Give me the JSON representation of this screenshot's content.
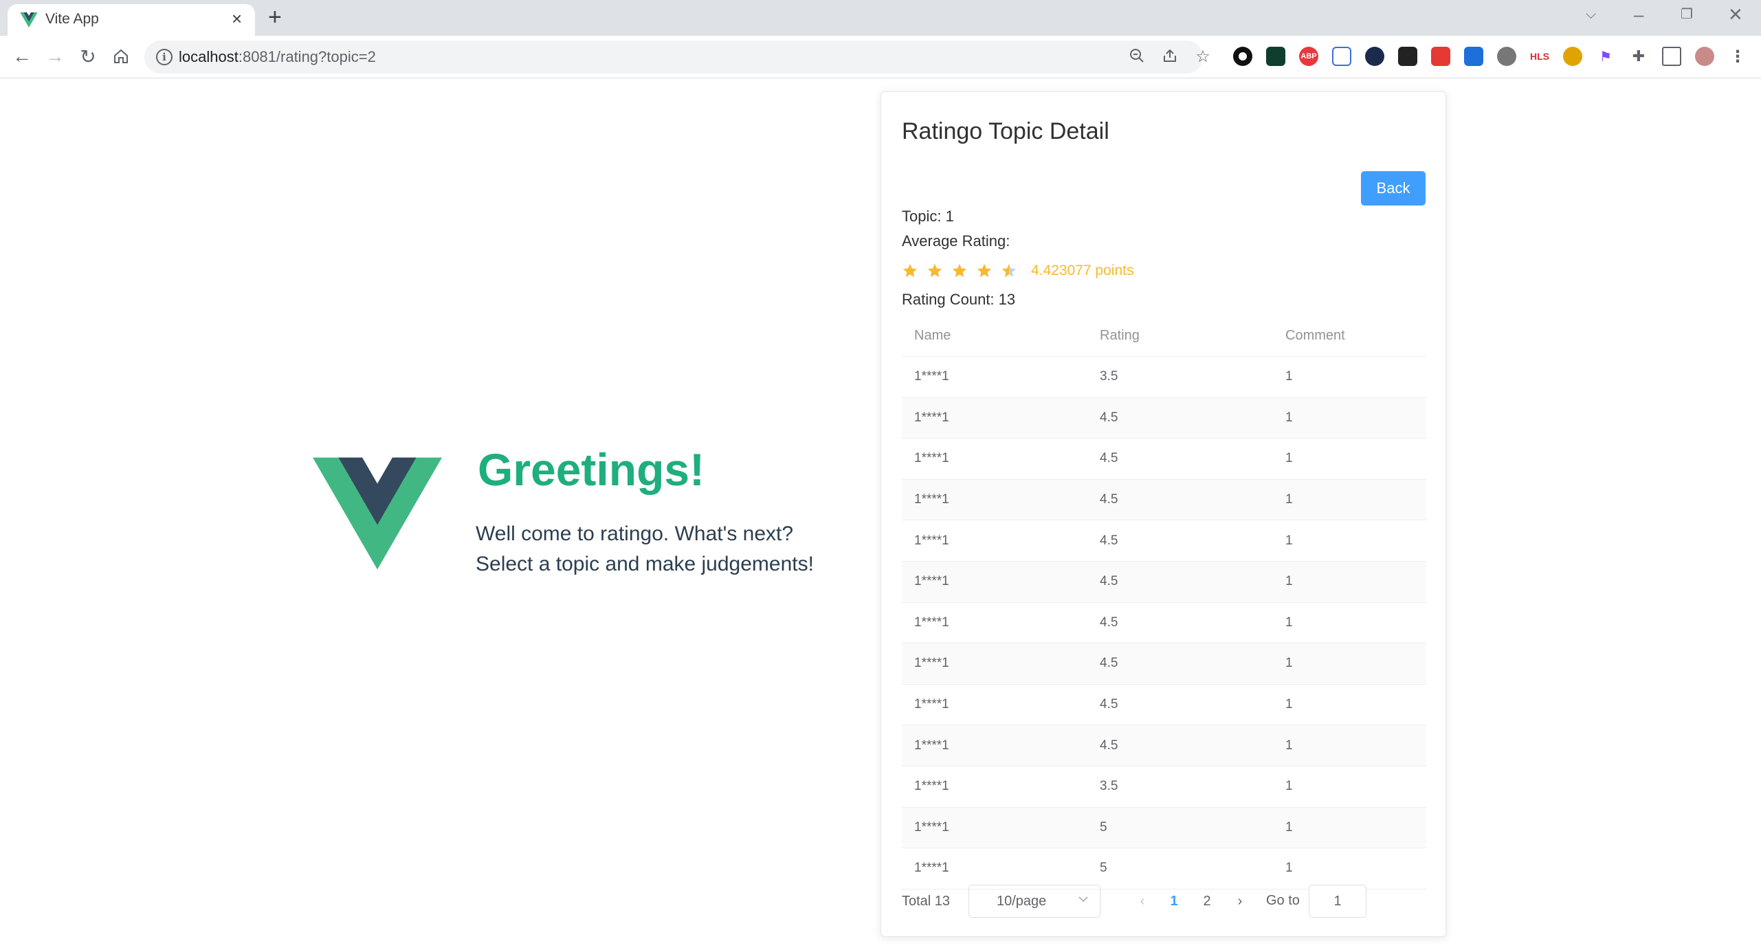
{
  "browser": {
    "tab_title": "Vite App",
    "url_host": "localhost",
    "url_rest": ":8081/rating?topic=2",
    "extensions": [
      {
        "name": "circle-ext",
        "label": "",
        "color": "#111111"
      },
      {
        "name": "terminal-ext",
        "label": "",
        "color": "#0f3d2e"
      },
      {
        "name": "adblock-ext",
        "label": "ABP",
        "color": "#e8383d"
      },
      {
        "name": "share-ext",
        "label": "",
        "color": "#3b6fd8"
      },
      {
        "name": "hex-ext",
        "label": "",
        "color": "#1b2b4d"
      },
      {
        "name": "grid-ext",
        "label": "",
        "color": "#222222"
      },
      {
        "name": "red-ext",
        "label": "",
        "color": "#e53935"
      },
      {
        "name": "edit-ext",
        "label": "",
        "color": "#1e6fd9"
      },
      {
        "name": "balls-ext",
        "label": "",
        "color": "#555555"
      },
      {
        "name": "hls-ext",
        "label": "HLS",
        "color": "#ffffff"
      },
      {
        "name": "face-ext",
        "label": "",
        "color": "#e0a400"
      },
      {
        "name": "flag-ext",
        "label": "",
        "color": "#7c4dff"
      }
    ]
  },
  "hero": {
    "greeting": "Greetings!",
    "line1": "Well come to ratingo. What's next?",
    "line2": "Select a topic and make judgements!"
  },
  "detail": {
    "title": "Ratingo Topic Detail",
    "back_label": "Back",
    "topic_line": "Topic: 1",
    "average_label": "Average Rating:",
    "average_value": 4.423077,
    "average_text": "4.423077 points",
    "count_line": "Rating Count: 13",
    "colors": {
      "star": "#f7ba2a",
      "star_empty": "#c6d1de",
      "primary": "#409eff"
    }
  },
  "table": {
    "headers": [
      "Name",
      "Rating",
      "Comment"
    ],
    "rows": [
      [
        "1****1",
        "3.5",
        "1"
      ],
      [
        "1****1",
        "4.5",
        "1"
      ],
      [
        "1****1",
        "4.5",
        "1"
      ],
      [
        "1****1",
        "4.5",
        "1"
      ],
      [
        "1****1",
        "4.5",
        "1"
      ],
      [
        "1****1",
        "4.5",
        "1"
      ],
      [
        "1****1",
        "4.5",
        "1"
      ],
      [
        "1****1",
        "4.5",
        "1"
      ],
      [
        "1****1",
        "4.5",
        "1"
      ],
      [
        "1****1",
        "4.5",
        "1"
      ],
      [
        "1****1",
        "3.5",
        "1"
      ],
      [
        "1****1",
        "5",
        "1"
      ],
      [
        "1****1",
        "5",
        "1"
      ]
    ]
  },
  "pagination": {
    "total_text": "Total 13",
    "page_size": "10/page",
    "pages": [
      "1",
      "2"
    ],
    "current_page": "1",
    "goto_label": "Go to",
    "goto_value": "1"
  }
}
